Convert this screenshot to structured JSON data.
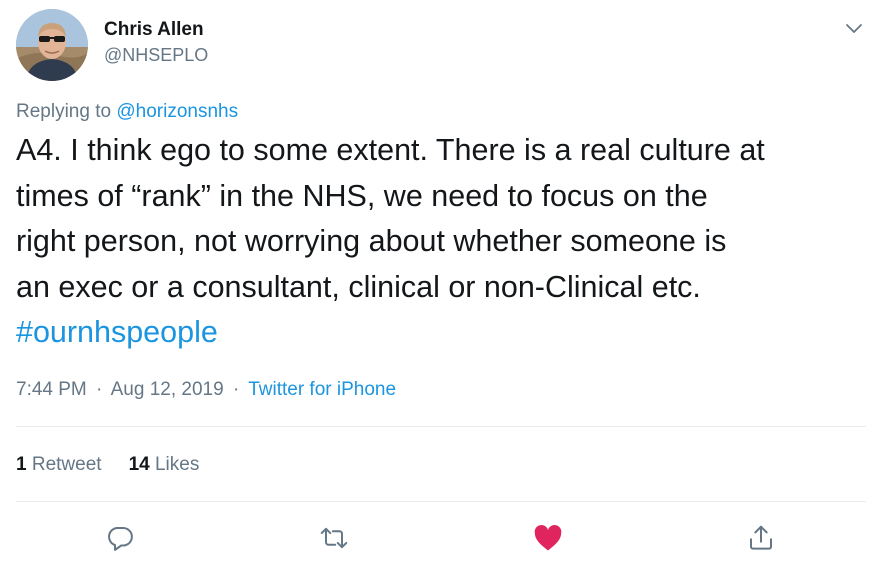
{
  "author": {
    "display_name": "Chris Allen",
    "handle": "@NHSEPLO"
  },
  "reply": {
    "prefix": "Replying to ",
    "to": "@horizonsnhs"
  },
  "tweet": {
    "text": "A4. I think ego to some extent. There is a real culture at\ntimes of “rank” in the NHS, we need to focus on the\nright person, not worrying about whether someone is\nan exec or a consultant, clinical or non-Clinical etc.",
    "hashtag": "#ournhspeople"
  },
  "meta": {
    "time": "7:44 PM",
    "separator": "·",
    "date": "Aug 12, 2019",
    "source": "Twitter for iPhone"
  },
  "stats": {
    "retweets_count": "1",
    "retweets_label": "Retweet",
    "likes_count": "14",
    "likes_label": "Likes"
  },
  "actions": [
    {
      "icon": "reply-icon"
    },
    {
      "icon": "retweet-icon"
    },
    {
      "icon": "heart-icon",
      "active": true
    },
    {
      "icon": "share-icon"
    }
  ],
  "colors": {
    "link": "#1b95e0",
    "muted": "#657786",
    "text": "#14171a",
    "like_active": "#e0245e",
    "divider": "#e6ecf0"
  }
}
